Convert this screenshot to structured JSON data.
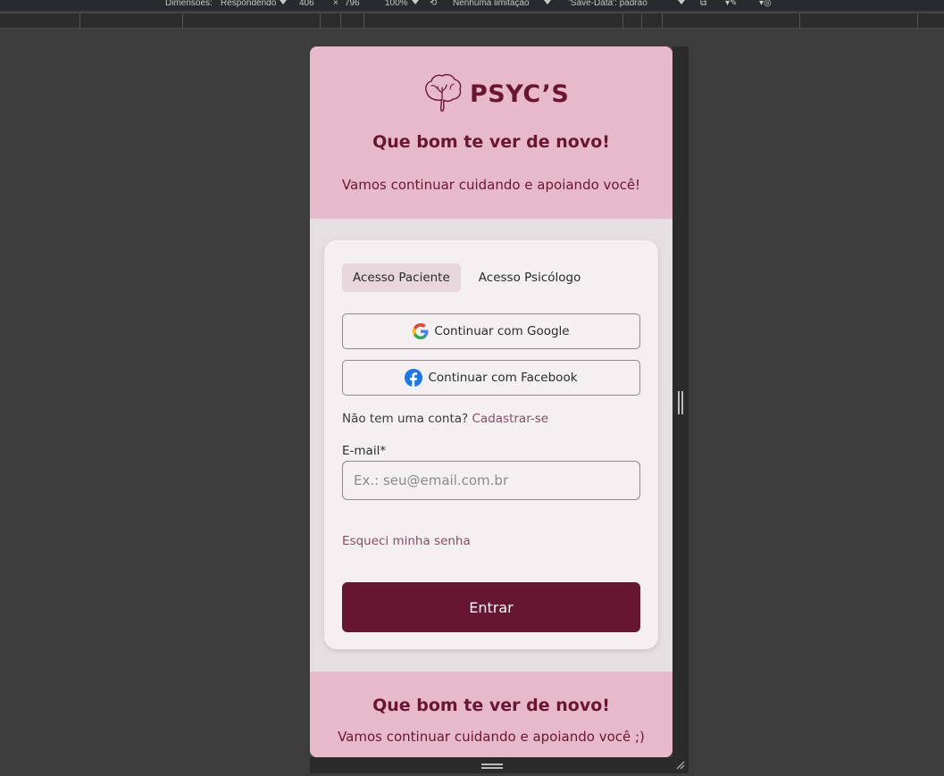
{
  "devtools": {
    "dimensions_label": "Dimensões:",
    "mode": "Respondendo",
    "width": "406",
    "times": "×",
    "height": "796",
    "zoom": "100%",
    "throttling": "Nenhuma limitação",
    "save_data": "'Save-Data': padrão"
  },
  "header": {
    "brand": "PSYC’S",
    "title": "Que bom te ver de novo!",
    "subtitle": "Vamos continuar cuidando e apoiando você!"
  },
  "tabs": [
    {
      "label": "Acesso Paciente",
      "active": true
    },
    {
      "label": "Acesso Psicólogo",
      "active": false
    }
  ],
  "social": {
    "google_label": "Continuar com Google",
    "facebook_label": "Continuar com Facebook"
  },
  "signup": {
    "prompt": "Não tem uma conta?",
    "link": "Cadastrar-se"
  },
  "form": {
    "email_label": "E-mail*",
    "email_placeholder": "Ex.: seu@email.com.br",
    "email_value": "",
    "forgot_label": "Esqueci minha senha",
    "submit_label": "Entrar"
  },
  "footer": {
    "title": "Que bom te ver de novo!",
    "subtitle": "Vamos continuar cuidando e apoiando você ;)"
  },
  "colors": {
    "brand": "#6a1631",
    "primary_button": "#661631",
    "header_bg": "#e6bacb",
    "card_bg": "#f4f0f1",
    "link": "#8a4a64",
    "facebook": "#1877f2"
  }
}
